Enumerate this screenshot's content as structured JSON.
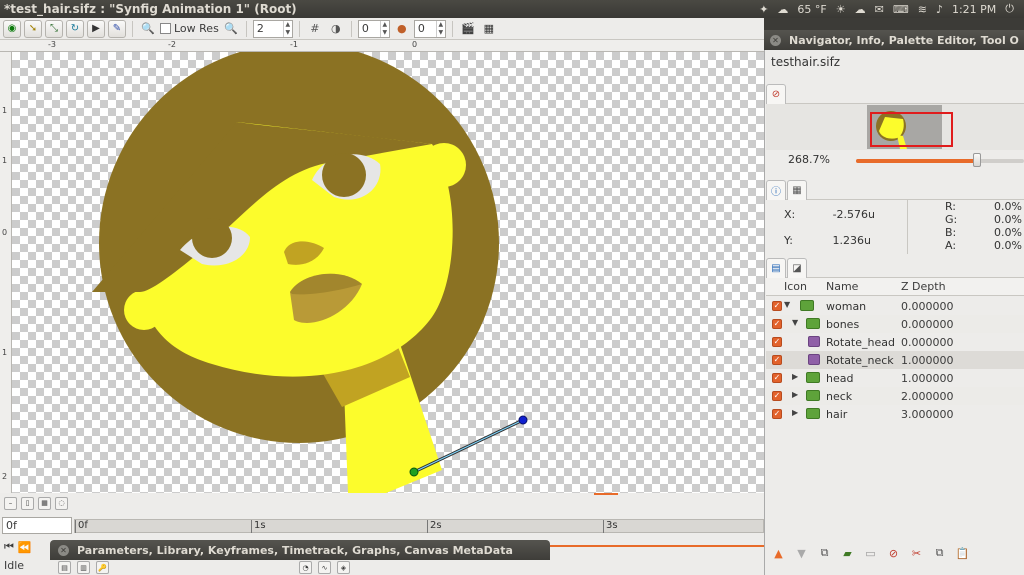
{
  "window": {
    "title": "*test_hair.sifz : \"Synfig Animation 1\" (Root)"
  },
  "tray": {
    "weather": "65 °F",
    "clock": "1:21 PM"
  },
  "toolbar": {
    "low_res_label": "Low Res",
    "resolution_value": "2",
    "onion_past_value": "0",
    "onion_future_value": "0"
  },
  "rulers": {
    "h_ticks": [
      "-3",
      "-2",
      "-1",
      "0"
    ],
    "v_ticks": [
      "1",
      "1",
      "0",
      "1",
      "2"
    ]
  },
  "timeline": {
    "current_time": "0f",
    "ticks": [
      "0f",
      "1s",
      "2s",
      "3s"
    ]
  },
  "status": {
    "text": "Idle"
  },
  "params_panel": {
    "title": "Parameters, Library, Keyframes, Timetrack, Graphs, Canvas MetaData"
  },
  "right_panel": {
    "title": "Navigator, Info, Palette Editor, Tool O",
    "file_tab": "testhair.sifz",
    "zoom": "268.7%",
    "zoom_level": 0.72,
    "info": {
      "x_label": "X:",
      "x_value": "-2.576u",
      "y_label": "Y:",
      "y_value": "1.236u",
      "r_label": "R:",
      "r_value": "0.0%",
      "g_label": "G:",
      "g_value": "0.0%",
      "b_label": "B:",
      "b_value": "0.0%",
      "a_label": "A:",
      "a_value": "0.0%"
    },
    "layers": {
      "headers": {
        "icon": "Icon",
        "name": "Name",
        "depth": "Z Depth"
      },
      "rows": [
        {
          "name": "woman",
          "depth": "0.000000"
        },
        {
          "name": "bones",
          "depth": "0.000000"
        },
        {
          "name": "Rotate_head",
          "depth": "0.000000"
        },
        {
          "name": "Rotate_neck",
          "depth": "1.000000"
        },
        {
          "name": "head",
          "depth": "1.000000"
        },
        {
          "name": "neck",
          "depth": "2.000000"
        },
        {
          "name": "hair",
          "depth": "3.000000"
        }
      ]
    }
  },
  "colors": {
    "hair": "#8b7223",
    "skin": "#fcfc2c",
    "shadow": "#c1a322",
    "lips": "#b99a37",
    "accent": "#e86b2a"
  }
}
